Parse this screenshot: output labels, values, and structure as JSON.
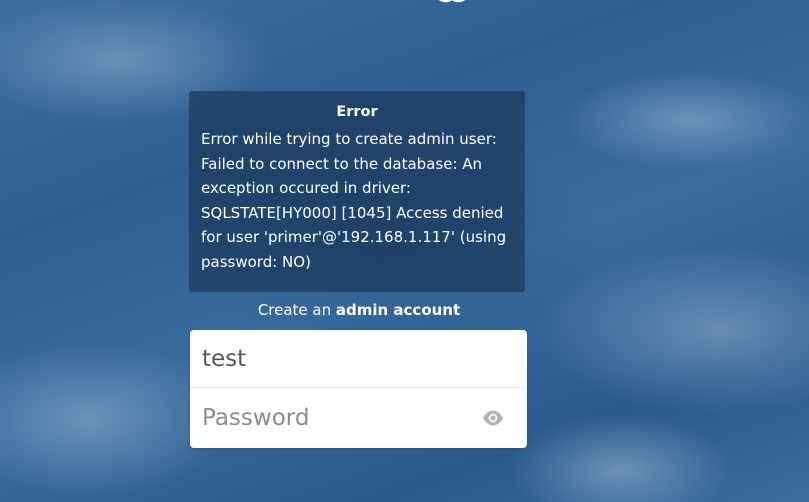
{
  "error": {
    "title": "Error",
    "message": "Error while trying to create admin user: Failed to connect to the database: An exception occured in driver: SQLSTATE[HY000] [1045] Access denied for user 'primer'@'192.168.1.117' (using password: NO)"
  },
  "subtitle": {
    "prefix": "Create an ",
    "bold": "admin account"
  },
  "form": {
    "username_value": "test",
    "password_placeholder": "Password"
  },
  "icons": {
    "password_toggle": "eye-icon",
    "logo": "logo-icon"
  }
}
